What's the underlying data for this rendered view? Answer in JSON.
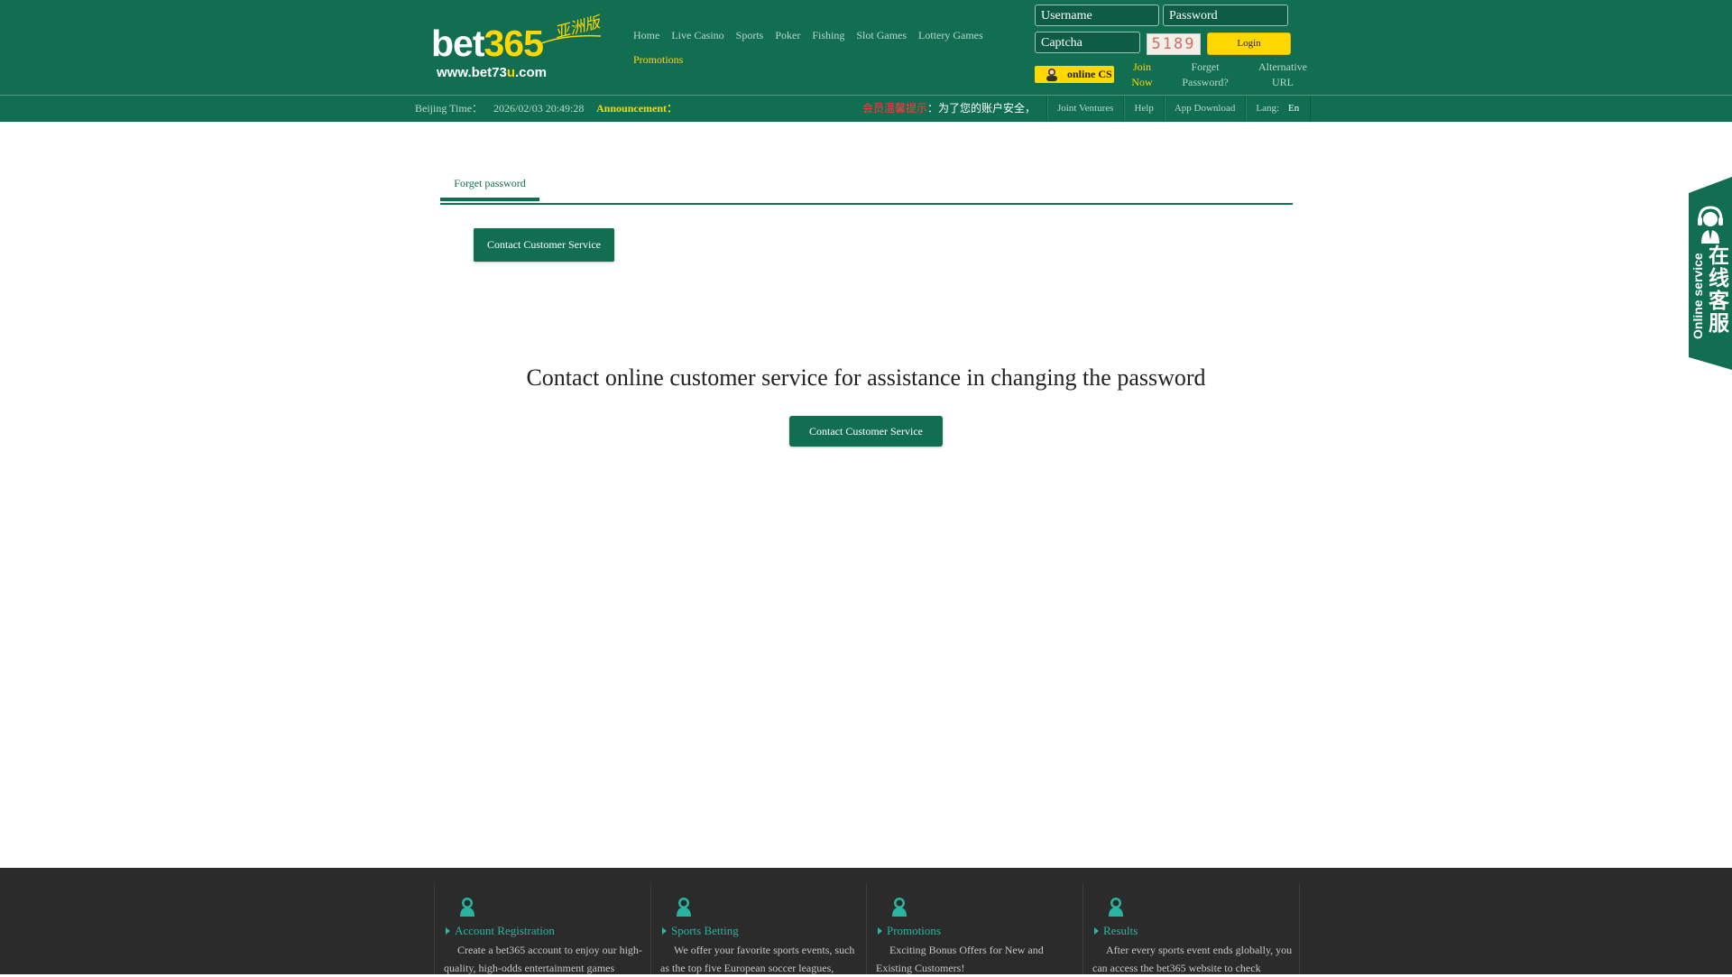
{
  "header": {
    "logo": {
      "brand_part1": "bet",
      "brand_part2": "365",
      "tagline": "亚洲版",
      "url_prefix": "www.bet73",
      "url_highlight": "u",
      "url_suffix": ".com"
    },
    "nav": [
      "Home",
      "Live Casino",
      "Sports",
      "Poker",
      "Fishing",
      "Slot Games",
      "Lottery Games",
      "Promotions"
    ],
    "active_nav": "Promotions",
    "login": {
      "username_placeholder": "Username",
      "password_placeholder": "Password",
      "captcha_placeholder": "Captcha",
      "captcha_code": "5189",
      "login_label": "Login",
      "online_cs_label": "online CS",
      "join_label": "Join Now",
      "forget_label": "Forget Password?",
      "alt_url_label": "Alternative URL"
    }
  },
  "topbar": {
    "time_label": "Beijing Time：",
    "time_value": "2026/02/03 20:49:28",
    "announcement_label": "Announcement：",
    "announcement_highlight": "会员温馨提示",
    "announcement_text": "：为了您的账户安全，",
    "links": [
      "Joint Ventures",
      "Help",
      "App Download"
    ],
    "lang_label": "Lang:",
    "lang_value": "En"
  },
  "main": {
    "tab_label": "Forget password",
    "contact_button_label": "Contact Customer Service",
    "headline": "Contact online customer service for assistance in changing the password",
    "contact_button2_label": "Contact Customer Service"
  },
  "float_service": {
    "label_en": "Online service",
    "label_cn_lines": [
      "在",
      "线",
      "客",
      "服"
    ]
  },
  "footer": {
    "columns": [
      {
        "title": "Account Registration",
        "desc": "Create a bet365 account to enjoy our high-quality, high-odds entertainment games"
      },
      {
        "title": "Sports Betting",
        "desc": "We offer your favorite sports events, such as the top five European soccer leagues,"
      },
      {
        "title": "Promotions",
        "desc": "Exciting Bonus Offers for New and Existing Customers!"
      },
      {
        "title": "Results",
        "desc": "After every sports event ends globally, you can access the bet365 website to check"
      }
    ]
  },
  "colors": {
    "brand_green": "#126e51",
    "accent_yellow": "#ffd800",
    "footer_bg": "#2b2b2b",
    "footer_title": "#29b6a0"
  }
}
